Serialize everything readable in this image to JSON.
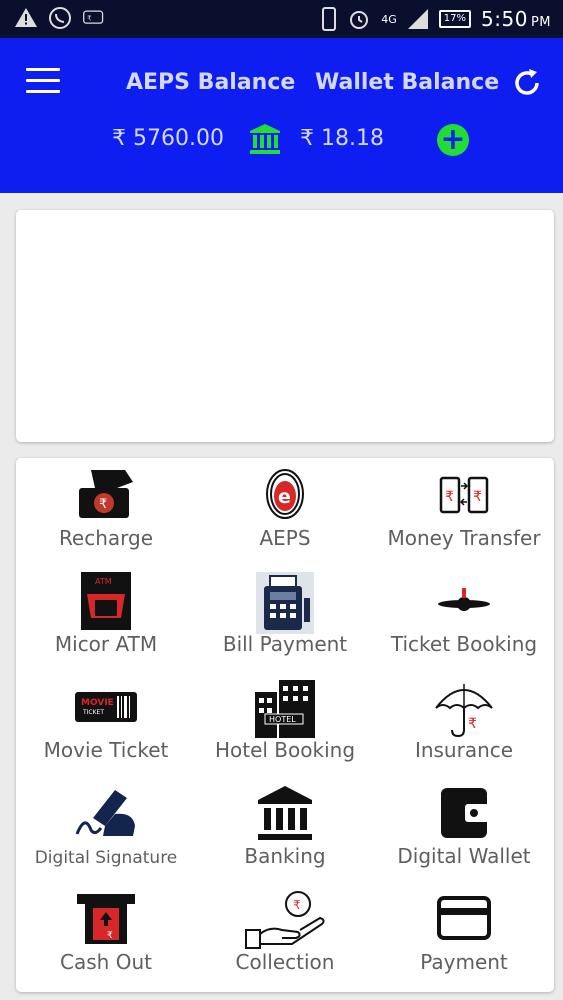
{
  "status_bar": {
    "network_type": "4G",
    "battery": "17%",
    "time": "5:50",
    "ampm": "PM",
    "icons": [
      "warning-icon",
      "whatsapp-icon",
      "app-notification-icon",
      "phone-icon",
      "alarm-icon",
      "signal-icon",
      "battery-icon"
    ]
  },
  "header": {
    "aeps_label": "AEPS Balance",
    "wallet_label": "Wallet Balance",
    "aeps_amount": "₹ 5760.00",
    "wallet_amount": "₹ 18.18",
    "add_label": "+",
    "accent_color": "#0f1ef0",
    "add_color": "#22dd33"
  },
  "services": [
    {
      "label": "Recharge",
      "icon": "mobile-recharge-icon"
    },
    {
      "label": "AEPS",
      "icon": "fingerprint-icon"
    },
    {
      "label": "Money Transfer",
      "icon": "phone-transfer-icon"
    },
    {
      "label": "Micor ATM",
      "icon": "atm-icon"
    },
    {
      "label": "Bill Payment",
      "icon": "pos-terminal-icon"
    },
    {
      "label": "Ticket Booking",
      "icon": "airplane-icon"
    },
    {
      "label": "Movie Ticket",
      "icon": "movie-ticket-icon"
    },
    {
      "label": "Hotel Booking",
      "icon": "hotel-icon"
    },
    {
      "label": "Insurance",
      "icon": "umbrella-icon"
    },
    {
      "label": "Digital Signature",
      "icon": "signature-icon"
    },
    {
      "label": "Banking",
      "icon": "bank-icon"
    },
    {
      "label": "Digital Wallet",
      "icon": "wallet-icon"
    },
    {
      "label": "Cash Out",
      "icon": "cash-out-icon"
    },
    {
      "label": "Collection",
      "icon": "collection-icon"
    },
    {
      "label": "Payment",
      "icon": "card-icon"
    }
  ]
}
